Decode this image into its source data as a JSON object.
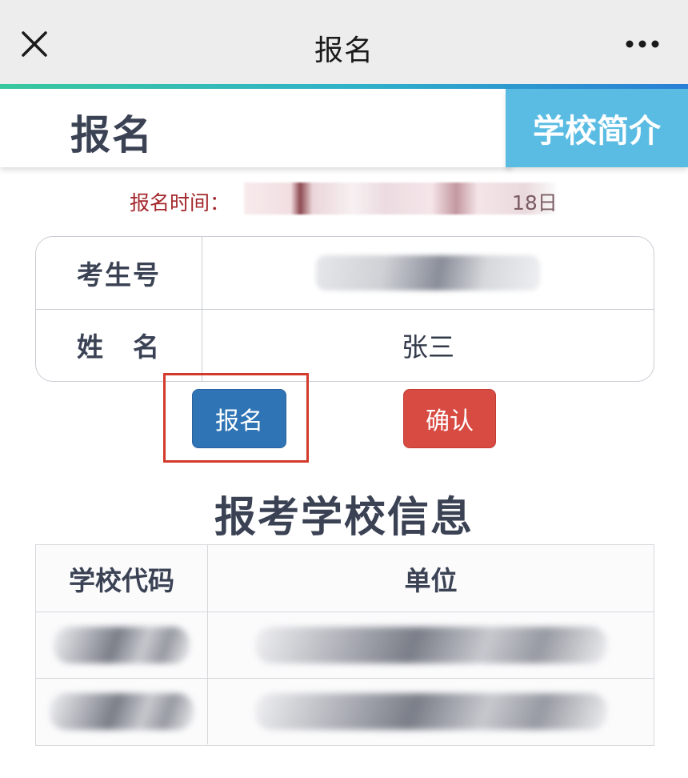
{
  "topbar": {
    "title": "报名",
    "close_icon": "close-icon",
    "more_icon": "more-icon"
  },
  "header": {
    "page_title": "报名",
    "intro_tab_label": "学校简介"
  },
  "registration": {
    "time_label": "报名时间：",
    "time_value_visible_suffix": "18日"
  },
  "student": {
    "rows": [
      {
        "label": "考生号",
        "value": ""
      },
      {
        "label": "姓　名",
        "value": "张三"
      }
    ]
  },
  "buttons": {
    "register_label": "报名",
    "confirm_label": "确认"
  },
  "school_section": {
    "title": "报考学校信息",
    "columns": [
      "学校代码",
      "单位"
    ],
    "rows": [
      {
        "code": "",
        "unit": ""
      },
      {
        "code": "",
        "unit": ""
      }
    ]
  },
  "colors": {
    "intro_tab": "#5bbce3",
    "register_button": "#2f74b5",
    "confirm_button": "#d84b43",
    "highlight_box": "#d23a2c",
    "time_text": "#a3272c"
  }
}
